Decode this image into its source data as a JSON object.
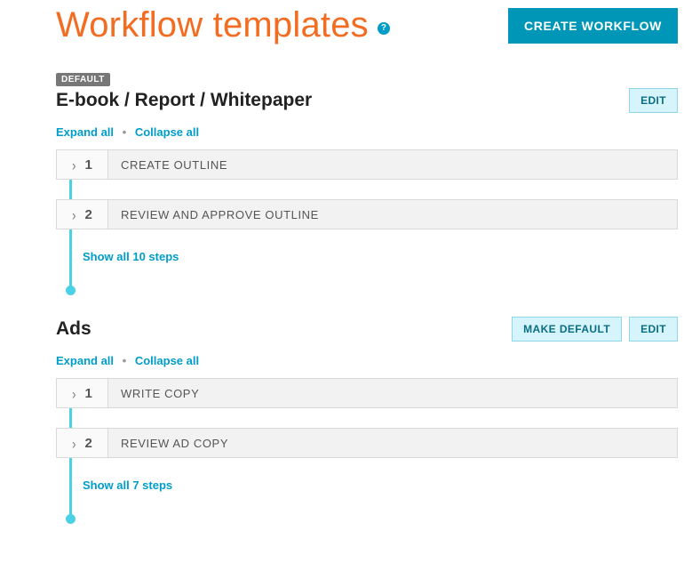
{
  "header": {
    "title": "Workflow templates",
    "help_glyph": "?",
    "create_button": "CREATE WORKFLOW"
  },
  "controls": {
    "expand_all": "Expand all",
    "collapse_all": "Collapse all",
    "dot": "•"
  },
  "buttons": {
    "edit": "EDIT",
    "make_default": "MAKE DEFAULT"
  },
  "workflows": [
    {
      "badge": "DEFAULT",
      "name": "E-book / Report / Whitepaper",
      "is_default": true,
      "steps": [
        {
          "num": "1",
          "title": "CREATE OUTLINE"
        },
        {
          "num": "2",
          "title": "REVIEW AND APPROVE OUTLINE"
        }
      ],
      "show_all": "Show all 10 steps"
    },
    {
      "badge": "",
      "name": "Ads",
      "is_default": false,
      "steps": [
        {
          "num": "1",
          "title": "WRITE COPY"
        },
        {
          "num": "2",
          "title": "REVIEW AD COPY"
        }
      ],
      "show_all": "Show all 7 steps"
    }
  ]
}
